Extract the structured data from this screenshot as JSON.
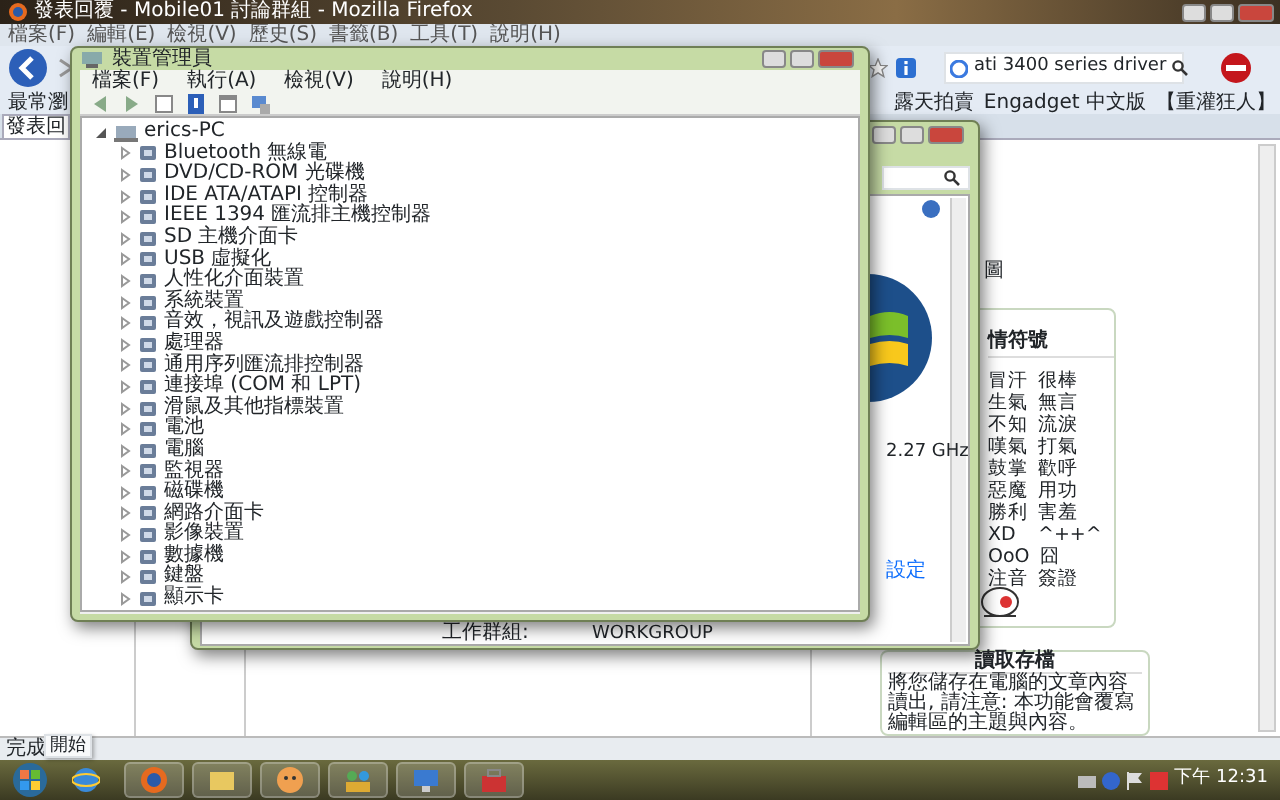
{
  "browser": {
    "title": "發表回覆 - Mobile01 討論群組 - Mozilla Firefox",
    "menu": [
      "檔案(F)",
      "編輯(E)",
      "檢視(V)",
      "歷史(S)",
      "書籤(B)",
      "工具(T)",
      "說明(H)"
    ],
    "search": {
      "value": "ati 3400 series driver"
    },
    "bookmarks": [
      "最常瀏",
      "露天拍賣",
      "Engadget 中文版",
      "【重灌狂人】"
    ],
    "tabs": [
      {
        "label": "發表回",
        "selected": true
      }
    ],
    "status": "完成"
  },
  "system_window": {
    "speed": "2.27 GHz",
    "link": "設定",
    "workgroup_label": "工作群組:",
    "workgroup": "WORKGROUP"
  },
  "device_manager": {
    "title": "裝置管理員",
    "menu": [
      "檔案(F)",
      "執行(A)",
      "檢視(V)",
      "說明(H)"
    ],
    "tree": {
      "label": "erics-PC",
      "expanded": true,
      "children": [
        {
          "label": "Bluetooth 無線電",
          "expanded": false
        },
        {
          "label": "DVD/CD-ROM 光碟機",
          "expanded": false
        },
        {
          "label": "IDE ATA/ATAPI 控制器",
          "expanded": false
        },
        {
          "label": "IEEE 1394 匯流排主機控制器",
          "expanded": false
        },
        {
          "label": "SD 主機介面卡",
          "expanded": false
        },
        {
          "label": "USB 虛擬化",
          "expanded": false
        },
        {
          "label": "人性化介面裝置",
          "expanded": false
        },
        {
          "label": "系統裝置",
          "expanded": false
        },
        {
          "label": "音效，視訊及遊戲控制器",
          "expanded": false
        },
        {
          "label": "處理器",
          "expanded": false
        },
        {
          "label": "通用序列匯流排控制器",
          "expanded": false
        },
        {
          "label": "連接埠 (COM 和 LPT)",
          "expanded": false
        },
        {
          "label": "滑鼠及其他指標裝置",
          "expanded": false
        },
        {
          "label": "電池",
          "expanded": false
        },
        {
          "label": "電腦",
          "expanded": false
        },
        {
          "label": "監視器",
          "expanded": false
        },
        {
          "label": "磁碟機",
          "expanded": false
        },
        {
          "label": "網路介面卡",
          "expanded": false
        },
        {
          "label": "影像裝置",
          "expanded": false
        },
        {
          "label": "數據機",
          "expanded": false
        },
        {
          "label": "鍵盤",
          "expanded": false
        },
        {
          "label": "顯示卡",
          "expanded": false
        }
      ]
    }
  },
  "page": {
    "side_label": "圖",
    "emoticons": {
      "heading": "情符號",
      "rows": [
        [
          "冒汗",
          "很棒"
        ],
        [
          "生氣",
          "無言"
        ],
        [
          "不知",
          "流淚"
        ],
        [
          "嘆氣",
          "打氣"
        ],
        [
          "鼓掌",
          "歡呼"
        ],
        [
          "惡魔",
          "用功"
        ],
        [
          "勝利",
          "害羞"
        ],
        [
          "XD",
          "^++^"
        ],
        [
          "OoO",
          "囧"
        ],
        [
          "注音",
          "簽證"
        ]
      ]
    },
    "load_panel": {
      "heading": "讀取存檔",
      "text": "將您儲存在電腦的文章內容讀出, 請注意: 本功能會覆寫編輯區的主題與內容。"
    }
  },
  "tooltip": "開始",
  "taskbar": {
    "clock": "下午 12:31"
  }
}
